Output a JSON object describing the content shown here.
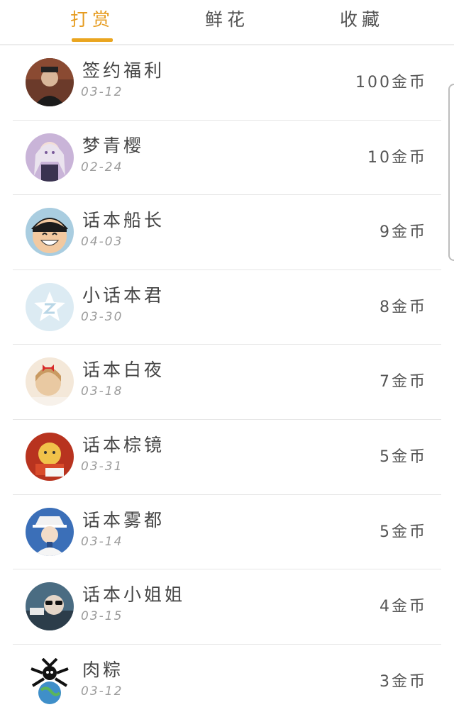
{
  "tabs": [
    {
      "label": "打赏",
      "active": true
    },
    {
      "label": "鲜花",
      "active": false
    },
    {
      "label": "收藏",
      "active": false
    }
  ],
  "accent_color": "#eaa51f",
  "rewards": [
    {
      "name": "签约福利",
      "date": "03-12",
      "amount": "100金币",
      "avatar": "portrait-avatar"
    },
    {
      "name": "梦青樱",
      "date": "02-24",
      "amount": "10金币",
      "avatar": "anime-girl-avatar"
    },
    {
      "name": "话本船长",
      "date": "04-03",
      "amount": "9金币",
      "avatar": "luffy-avatar"
    },
    {
      "name": "小话本君",
      "date": "03-30",
      "amount": "8金币",
      "avatar": "default-star-avatar"
    },
    {
      "name": "话本白夜",
      "date": "03-18",
      "amount": "7金币",
      "avatar": "girl-red-bow-avatar"
    },
    {
      "name": "话本棕镜",
      "date": "03-31",
      "amount": "5金币",
      "avatar": "cartoon-avatar"
    },
    {
      "name": "话本雾都",
      "date": "03-14",
      "amount": "5金币",
      "avatar": "kid-avatar"
    },
    {
      "name": "话本小姐姐",
      "date": "03-15",
      "amount": "4金币",
      "avatar": "sunglasses-avatar"
    },
    {
      "name": "肉粽",
      "date": "03-12",
      "amount": "3金币",
      "avatar": "globe-avatar"
    }
  ]
}
